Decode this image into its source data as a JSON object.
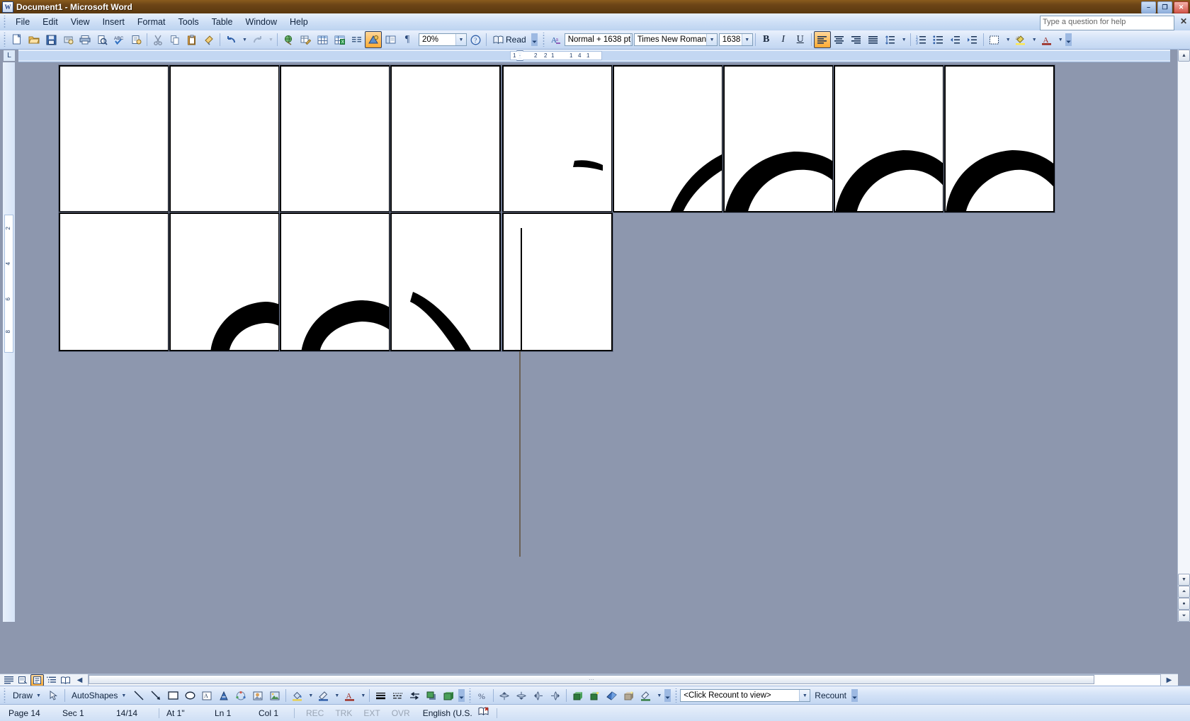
{
  "window": {
    "title": "Document1 - Microsoft Word",
    "app_icon": "word-icon",
    "minimize": "–",
    "maximize": "❐",
    "close": "✕"
  },
  "menubar": {
    "items": [
      "File",
      "Edit",
      "View",
      "Insert",
      "Format",
      "Tools",
      "Table",
      "Window",
      "Help"
    ],
    "help_box_placeholder": "Type a question for help",
    "help_box_value": "Type a question for help",
    "close_doc": "✕"
  },
  "standard_toolbar": {
    "buttons": [
      {
        "name": "new-blank-document-icon",
        "glyph": "🗋"
      },
      {
        "name": "open-icon",
        "glyph": "📂"
      },
      {
        "name": "save-icon",
        "glyph": "💾"
      },
      {
        "name": "permission-icon",
        "glyph": "🖨"
      },
      {
        "name": "print-icon",
        "glyph": "🖶"
      },
      {
        "name": "print-preview-icon",
        "glyph": "🔍"
      },
      {
        "name": "spelling-grammar-icon",
        "glyph": "ABC"
      },
      {
        "name": "research-icon",
        "glyph": "📑"
      },
      {
        "name": "cut-icon",
        "glyph": "✂"
      },
      {
        "name": "copy-icon",
        "glyph": "⧉"
      },
      {
        "name": "paste-icon",
        "glyph": "📋"
      },
      {
        "name": "format-painter-icon",
        "glyph": "🖌"
      },
      {
        "name": "undo-icon",
        "glyph": "↶"
      },
      {
        "name": "redo-icon",
        "glyph": "↷"
      },
      {
        "name": "insert-hyperlink-icon",
        "glyph": "🌐"
      },
      {
        "name": "tables-and-borders-icon",
        "glyph": "🖉"
      },
      {
        "name": "insert-table-icon",
        "glyph": "▦"
      },
      {
        "name": "insert-excel-worksheet-icon",
        "glyph": "▩"
      },
      {
        "name": "columns-icon",
        "glyph": "☰"
      },
      {
        "name": "drawing-icon",
        "glyph": "◪"
      },
      {
        "name": "document-map-icon",
        "glyph": "🗺"
      },
      {
        "name": "show-formatting-marks-icon",
        "glyph": "¶"
      }
    ],
    "zoom_value": "20%",
    "help_icon": "?",
    "read_label": "Read",
    "read_icon": "book-icon"
  },
  "formatting_toolbar": {
    "styles_icon": "style-icon",
    "style_value": "Normal + 1638 pt",
    "font_value": "Times New Roman",
    "size_value": "1638",
    "bold": "B",
    "italic": "I",
    "underline": "U",
    "align_left": "align-left",
    "align_center": "align-center",
    "align_right": "align-right",
    "align_justify": "align-justify",
    "line_spacing": "line-spacing",
    "numbering": "numbering",
    "bullets": "bullets",
    "decrease_indent": "decrease-indent",
    "increase_indent": "increase-indent",
    "outside_border": "outside-border",
    "highlight": "ab",
    "font_color": "A"
  },
  "ruler": {
    "corner_label": "L",
    "h_ticks": [
      "1",
      "2",
      "1",
      "1",
      "4",
      "1"
    ],
    "h_numbers": [
      "2",
      "4"
    ],
    "v_numbers": [
      "2",
      "4",
      "6",
      "8"
    ]
  },
  "document": {
    "pages_row1": 9,
    "pages_row2": 5,
    "page_fill": "#ffffff",
    "page_border": "#000000",
    "canvas_background": "#8D97AE",
    "glyph_color": "#000000",
    "caret_color": "#000000",
    "caret_tail_color": "#6b6257"
  },
  "view_buttons": [
    {
      "name": "normal-view-button",
      "glyph": "☰"
    },
    {
      "name": "web-layout-view-button",
      "glyph": "🗗"
    },
    {
      "name": "print-layout-view-button",
      "glyph": "▤"
    },
    {
      "name": "outline-view-button",
      "glyph": "⁝☰"
    },
    {
      "name": "reading-layout-view-button",
      "glyph": "📖"
    }
  ],
  "drawing_toolbar": {
    "draw_label": "Draw",
    "select_objects_icon": "arrow-cursor-icon",
    "autoshapes_label": "AutoShapes",
    "buttons": [
      {
        "name": "line-icon",
        "glyph": "╲"
      },
      {
        "name": "arrow-icon",
        "glyph": "↘"
      },
      {
        "name": "rectangle-icon",
        "glyph": "▭"
      },
      {
        "name": "oval-icon",
        "glyph": "◯"
      },
      {
        "name": "text-box-icon",
        "glyph": "▤"
      },
      {
        "name": "insert-wordart-icon",
        "glyph": "◢"
      },
      {
        "name": "insert-diagram-icon",
        "glyph": "❂"
      },
      {
        "name": "insert-clip-art-icon",
        "glyph": "▧"
      },
      {
        "name": "insert-picture-icon",
        "glyph": "🖼"
      },
      {
        "name": "fill-color-icon",
        "glyph": "🪣"
      },
      {
        "name": "line-color-icon",
        "glyph": "🖊"
      },
      {
        "name": "font-color-icon",
        "glyph": "A"
      },
      {
        "name": "line-style-icon",
        "glyph": "≡"
      },
      {
        "name": "dash-style-icon",
        "glyph": "┄"
      },
      {
        "name": "arrow-style-icon",
        "glyph": "⇄"
      },
      {
        "name": "shadow-style-icon",
        "glyph": "◧"
      },
      {
        "name": "3d-style-icon",
        "glyph": "◨"
      }
    ],
    "wordcount_buttons": [
      {
        "name": "word-count-percent-icon",
        "glyph": "%"
      },
      {
        "name": "flip-vertical-icon",
        "glyph": "⇕"
      },
      {
        "name": "rotate-icon",
        "glyph": "⟳"
      },
      {
        "name": "flip-horizontal-icon",
        "glyph": "◑"
      },
      {
        "name": "mirror-icon",
        "glyph": "◐"
      },
      {
        "name": "3d-tilt-up-icon",
        "glyph": "◰"
      },
      {
        "name": "3d-tilt-down-icon",
        "glyph": "◳"
      },
      {
        "name": "3d-color-icon",
        "glyph": "◆"
      },
      {
        "name": "3d-depth-icon",
        "glyph": "◈"
      },
      {
        "name": "3d-surface-icon",
        "glyph": "◩"
      }
    ]
  },
  "wordcount_toolbar": {
    "count_value": "<Click Recount to view>",
    "recount_label": "Recount"
  },
  "statusbar": {
    "page": "Page 14",
    "section": "Sec 1",
    "pages": "14/14",
    "at": "At 1\"",
    "line": "Ln 1",
    "column": "Col 1",
    "rec": "REC",
    "trk": "TRK",
    "ext": "EXT",
    "ovr": "OVR",
    "language": "English (U.S.",
    "spellcheck_icon": "spelling-status-icon"
  },
  "scroll": {
    "up_arrow": "▲",
    "down_arrow": "▼",
    "left_arrow": "◀",
    "right_arrow": "▶",
    "prev_page": "⏶",
    "select_browse_object": "●",
    "next_page": "⏷",
    "thumb_grip": "⋯"
  }
}
